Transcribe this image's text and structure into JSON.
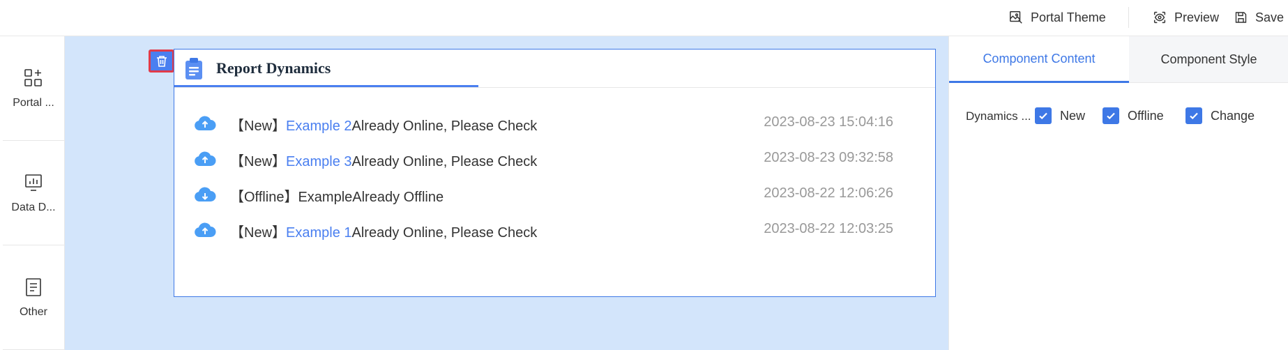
{
  "topbar": {
    "portal_theme": "Portal Theme",
    "preview": "Preview",
    "save": "Save"
  },
  "sidebar": {
    "items": [
      {
        "label": "Portal ...",
        "icon": "add-components-icon"
      },
      {
        "label": "Data D...",
        "icon": "chart-icon"
      },
      {
        "label": "Other",
        "icon": "document-icon"
      }
    ]
  },
  "widget": {
    "title": "Report Dynamics",
    "dynamics": [
      {
        "type": "upload",
        "prefix": "【New】",
        "link": "Example 2",
        "suffix": "Already Online, Please Check",
        "time": "2023-08-23 15:04:16"
      },
      {
        "type": "upload",
        "prefix": "【New】",
        "link": "Example 3",
        "suffix": "Already Online, Please Check",
        "time": "2023-08-23 09:32:58"
      },
      {
        "type": "download",
        "prefix": "【Offline】",
        "link": "",
        "suffix": "ExampleAlready Offline",
        "time": "2023-08-22 12:06:26"
      },
      {
        "type": "upload",
        "prefix": "【New】",
        "link": "Example 1",
        "suffix": "Already Online, Please Check",
        "time": "2023-08-22 12:03:25"
      }
    ]
  },
  "right_panel": {
    "tabs": [
      "Component Content",
      "Component Style"
    ],
    "field_label": "Dynamics ...",
    "checkboxes": [
      {
        "label": "New",
        "checked": true
      },
      {
        "label": "Offline",
        "checked": true
      },
      {
        "label": "Change",
        "checked": true
      }
    ]
  },
  "colors": {
    "accent": "#3e78e6",
    "canvas_bg": "#d3e5fb",
    "delete_border": "#e13b4a",
    "time_gray": "#999999"
  }
}
